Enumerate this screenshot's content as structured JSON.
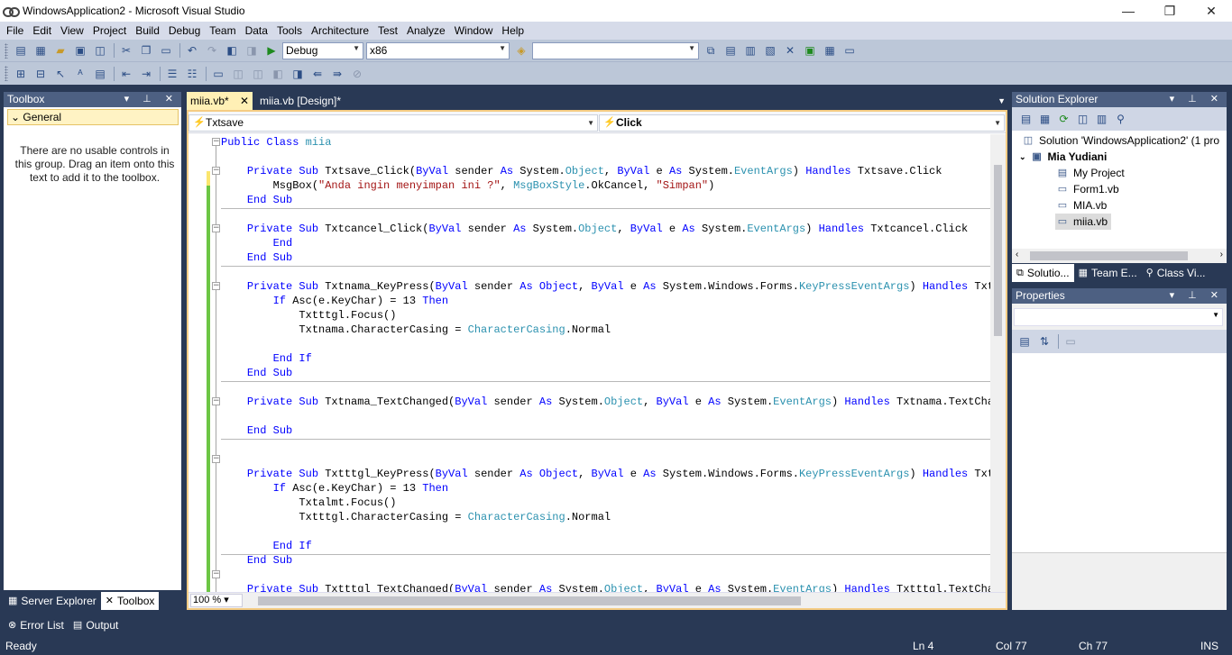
{
  "window": {
    "title": "WindowsApplication2 - Microsoft Visual Studio",
    "minimize": "—",
    "maximize": "❐",
    "close": "✕"
  },
  "menu": [
    "File",
    "Edit",
    "View",
    "Project",
    "Build",
    "Debug",
    "Team",
    "Data",
    "Tools",
    "Architecture",
    "Test",
    "Analyze",
    "Window",
    "Help"
  ],
  "toolbar": {
    "config": "Debug",
    "platform": "x86",
    "find_value": ""
  },
  "toolbox": {
    "title": "Toolbox",
    "group": "General",
    "empty_message": "There are no usable controls in this group. Drag an item onto this text to add it to the toolbox.",
    "tabs": [
      "Server Explorer",
      "Toolbox"
    ]
  },
  "documents": {
    "tabs": [
      "miia.vb*",
      "miia.vb [Design]*"
    ],
    "nav_object": "Txtsave",
    "nav_event": "Click"
  },
  "code_lines": [
    {
      "segs": [
        {
          "t": "Public Class ",
          "c": "kw"
        },
        {
          "t": "miia",
          "c": "ty"
        }
      ]
    },
    {
      "segs": []
    },
    {
      "segs": [
        {
          "t": "    "
        },
        {
          "t": "Private Sub",
          "c": "kw"
        },
        {
          "t": " Txtsave_Click("
        },
        {
          "t": "ByVal",
          "c": "kw"
        },
        {
          "t": " sender "
        },
        {
          "t": "As",
          "c": "kw"
        },
        {
          "t": " System."
        },
        {
          "t": "Object",
          "c": "ty"
        },
        {
          "t": ", "
        },
        {
          "t": "ByVal",
          "c": "kw"
        },
        {
          "t": " e "
        },
        {
          "t": "As",
          "c": "kw"
        },
        {
          "t": " System."
        },
        {
          "t": "EventArgs",
          "c": "ty"
        },
        {
          "t": ") "
        },
        {
          "t": "Handles",
          "c": "kw"
        },
        {
          "t": " Txtsave.Click"
        }
      ]
    },
    {
      "segs": [
        {
          "t": "        MsgBox("
        },
        {
          "t": "\"Anda ingin menyimpan ini ?\"",
          "c": "st"
        },
        {
          "t": ", "
        },
        {
          "t": "MsgBoxStyle",
          "c": "ty"
        },
        {
          "t": ".OkCancel, "
        },
        {
          "t": "\"Simpan\"",
          "c": "st"
        },
        {
          "t": ")"
        }
      ]
    },
    {
      "segs": [
        {
          "t": "    "
        },
        {
          "t": "End Sub",
          "c": "kw"
        }
      ]
    },
    {
      "segs": []
    },
    {
      "segs": [
        {
          "t": "    "
        },
        {
          "t": "Private Sub",
          "c": "kw"
        },
        {
          "t": " Txtcancel_Click("
        },
        {
          "t": "ByVal",
          "c": "kw"
        },
        {
          "t": " sender "
        },
        {
          "t": "As",
          "c": "kw"
        },
        {
          "t": " System."
        },
        {
          "t": "Object",
          "c": "ty"
        },
        {
          "t": ", "
        },
        {
          "t": "ByVal",
          "c": "kw"
        },
        {
          "t": " e "
        },
        {
          "t": "As",
          "c": "kw"
        },
        {
          "t": " System."
        },
        {
          "t": "EventArgs",
          "c": "ty"
        },
        {
          "t": ") "
        },
        {
          "t": "Handles",
          "c": "kw"
        },
        {
          "t": " Txtcancel.Click"
        }
      ]
    },
    {
      "segs": [
        {
          "t": "        "
        },
        {
          "t": "End",
          "c": "kw"
        }
      ]
    },
    {
      "segs": [
        {
          "t": "    "
        },
        {
          "t": "End Sub",
          "c": "kw"
        }
      ]
    },
    {
      "segs": []
    },
    {
      "segs": [
        {
          "t": "    "
        },
        {
          "t": "Private Sub",
          "c": "kw"
        },
        {
          "t": " Txtnama_KeyPress("
        },
        {
          "t": "ByVal",
          "c": "kw"
        },
        {
          "t": " sender "
        },
        {
          "t": "As",
          "c": "kw"
        },
        {
          "t": " "
        },
        {
          "t": "Object",
          "c": "kw"
        },
        {
          "t": ", "
        },
        {
          "t": "ByVal",
          "c": "kw"
        },
        {
          "t": " e "
        },
        {
          "t": "As",
          "c": "kw"
        },
        {
          "t": " System.Windows.Forms."
        },
        {
          "t": "KeyPressEventArgs",
          "c": "ty"
        },
        {
          "t": ") "
        },
        {
          "t": "Handles",
          "c": "kw"
        },
        {
          "t": " Txtnam"
        }
      ]
    },
    {
      "segs": [
        {
          "t": "        "
        },
        {
          "t": "If",
          "c": "kw"
        },
        {
          "t": " Asc(e.KeyChar) = 13 "
        },
        {
          "t": "Then",
          "c": "kw"
        }
      ]
    },
    {
      "segs": [
        {
          "t": "            Txtttgl.Focus()"
        }
      ]
    },
    {
      "segs": [
        {
          "t": "            Txtnama.CharacterCasing = "
        },
        {
          "t": "CharacterCasing",
          "c": "ty"
        },
        {
          "t": ".Normal"
        }
      ]
    },
    {
      "segs": []
    },
    {
      "segs": [
        {
          "t": "        "
        },
        {
          "t": "End If",
          "c": "kw"
        }
      ]
    },
    {
      "segs": [
        {
          "t": "    "
        },
        {
          "t": "End Sub",
          "c": "kw"
        }
      ]
    },
    {
      "segs": []
    },
    {
      "segs": [
        {
          "t": "    "
        },
        {
          "t": "Private Sub",
          "c": "kw"
        },
        {
          "t": " Txtnama_TextChanged("
        },
        {
          "t": "ByVal",
          "c": "kw"
        },
        {
          "t": " sender "
        },
        {
          "t": "As",
          "c": "kw"
        },
        {
          "t": " System."
        },
        {
          "t": "Object",
          "c": "ty"
        },
        {
          "t": ", "
        },
        {
          "t": "ByVal",
          "c": "kw"
        },
        {
          "t": " e "
        },
        {
          "t": "As",
          "c": "kw"
        },
        {
          "t": " System."
        },
        {
          "t": "EventArgs",
          "c": "ty"
        },
        {
          "t": ") "
        },
        {
          "t": "Handles",
          "c": "kw"
        },
        {
          "t": " Txtnama.TextChange"
        }
      ]
    },
    {
      "segs": []
    },
    {
      "segs": [
        {
          "t": "    "
        },
        {
          "t": "End Sub",
          "c": "kw"
        }
      ]
    },
    {
      "segs": []
    },
    {
      "segs": []
    },
    {
      "segs": [
        {
          "t": "    "
        },
        {
          "t": "Private Sub",
          "c": "kw"
        },
        {
          "t": " Txtttgl_KeyPress("
        },
        {
          "t": "ByVal",
          "c": "kw"
        },
        {
          "t": " sender "
        },
        {
          "t": "As",
          "c": "kw"
        },
        {
          "t": " "
        },
        {
          "t": "Object",
          "c": "kw"
        },
        {
          "t": ", "
        },
        {
          "t": "ByVal",
          "c": "kw"
        },
        {
          "t": " e "
        },
        {
          "t": "As",
          "c": "kw"
        },
        {
          "t": " System.Windows.Forms."
        },
        {
          "t": "KeyPressEventArgs",
          "c": "ty"
        },
        {
          "t": ") "
        },
        {
          "t": "Handles",
          "c": "kw"
        },
        {
          "t": " Txtttg"
        }
      ]
    },
    {
      "segs": [
        {
          "t": "        "
        },
        {
          "t": "If",
          "c": "kw"
        },
        {
          "t": " Asc(e.KeyChar) = 13 "
        },
        {
          "t": "Then",
          "c": "kw"
        }
      ]
    },
    {
      "segs": [
        {
          "t": "            Txtalmt.Focus()"
        }
      ]
    },
    {
      "segs": [
        {
          "t": "            Txtttgl.CharacterCasing = "
        },
        {
          "t": "CharacterCasing",
          "c": "ty"
        },
        {
          "t": ".Normal"
        }
      ]
    },
    {
      "segs": []
    },
    {
      "segs": [
        {
          "t": "        "
        },
        {
          "t": "End If",
          "c": "kw"
        }
      ]
    },
    {
      "segs": [
        {
          "t": "    "
        },
        {
          "t": "End Sub",
          "c": "kw"
        }
      ]
    },
    {
      "segs": []
    },
    {
      "segs": [
        {
          "t": "    "
        },
        {
          "t": "Private Sub",
          "c": "kw"
        },
        {
          "t": " Txtttgl_TextChanged("
        },
        {
          "t": "ByVal",
          "c": "kw"
        },
        {
          "t": " sender "
        },
        {
          "t": "As",
          "c": "kw"
        },
        {
          "t": " System."
        },
        {
          "t": "Object",
          "c": "ty"
        },
        {
          "t": ", "
        },
        {
          "t": "ByVal",
          "c": "kw"
        },
        {
          "t": " e "
        },
        {
          "t": "As",
          "c": "kw"
        },
        {
          "t": " System."
        },
        {
          "t": "EventArgs",
          "c": "ty"
        },
        {
          "t": ") "
        },
        {
          "t": "Handles",
          "c": "kw"
        },
        {
          "t": " Txtttgl.TextChange"
        }
      ]
    }
  ],
  "editor": {
    "zoom": "100 %"
  },
  "solution_explorer": {
    "title": "Solution Explorer",
    "items": [
      {
        "label": "Solution 'WindowsApplication2' (1 pro",
        "icon": "solution-icon"
      },
      {
        "label": "Mia Yudiani",
        "icon": "vb-project-icon"
      },
      {
        "label": "My Project",
        "icon": "my-project-icon"
      },
      {
        "label": "Form1.vb",
        "icon": "form-icon"
      },
      {
        "label": "MIA.vb",
        "icon": "form-icon"
      },
      {
        "label": "miia.vb",
        "icon": "form-icon"
      }
    ],
    "tabs": [
      "Solutio...",
      "Team E...",
      "Class Vi..."
    ]
  },
  "properties": {
    "title": "Properties"
  },
  "output_tabs": [
    "Error List",
    "Output"
  ],
  "status": {
    "ready": "Ready",
    "ln": "Ln 4",
    "col": "Col 77",
    "ch": "Ch 77",
    "ins": "INS"
  },
  "colors": {
    "chrome": "#293955",
    "keyword": "#0000ff",
    "type": "#2b91af",
    "string": "#a31515",
    "active_tab": "#fff0b5"
  }
}
